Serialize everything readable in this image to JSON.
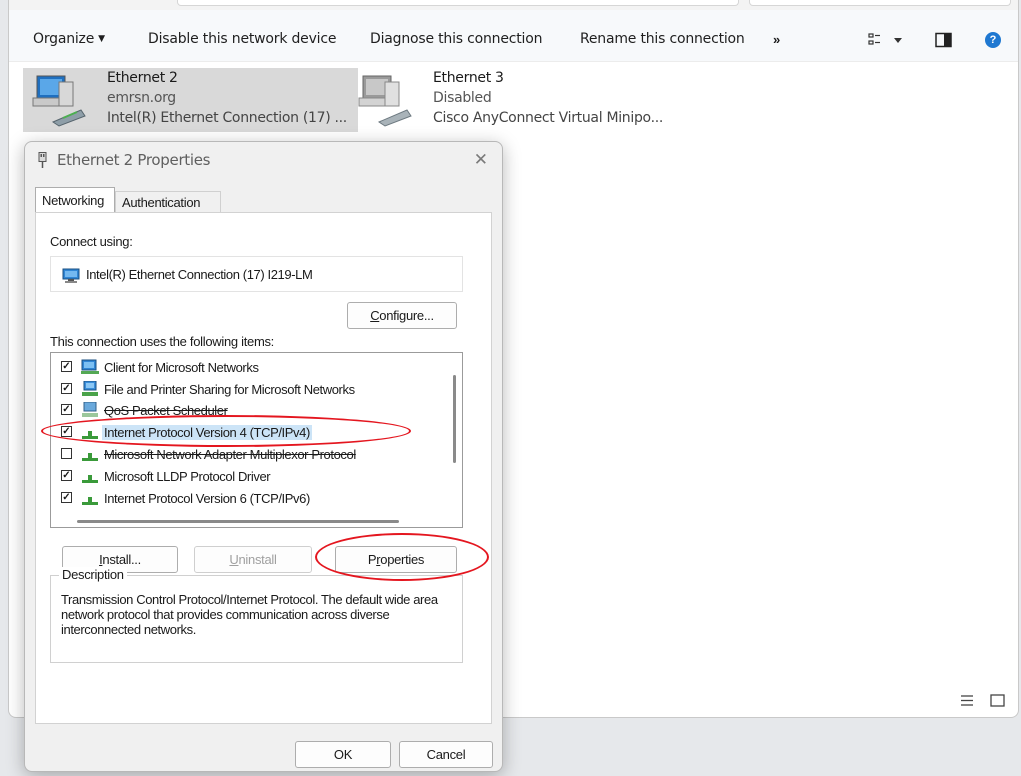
{
  "toolbar": {
    "organize": "Organize",
    "disable": "Disable this network device",
    "diagnose": "Diagnose this connection",
    "rename": "Rename this connection",
    "more": "»",
    "help": "?"
  },
  "adapters": [
    {
      "name": "Ethernet 2",
      "status": "emrsn.org",
      "device": "Intel(R) Ethernet Connection (17) ..."
    },
    {
      "name": "Ethernet 3",
      "status": "Disabled",
      "device": "Cisco AnyConnect Virtual Minipo..."
    }
  ],
  "dialog": {
    "title": "Ethernet 2 Properties",
    "tabs": [
      "Networking",
      "Authentication"
    ],
    "connect_using_label": "Connect using:",
    "adapter_name": "Intel(R) Ethernet Connection (17) I219-LM",
    "configure": "Configure...",
    "items_label": "This connection uses the following items:",
    "items": [
      {
        "label": "Client for Microsoft Networks",
        "checked": true,
        "icon": "network-client-icon"
      },
      {
        "label": "File and Printer Sharing for Microsoft Networks",
        "checked": true,
        "icon": "file-sharing-icon"
      },
      {
        "label": "QoS Packet Scheduler",
        "checked": true,
        "icon": "service-icon"
      },
      {
        "label": "Internet Protocol Version 4 (TCP/IPv4)",
        "checked": true,
        "icon": "protocol-icon"
      },
      {
        "label": "Microsoft Network Adapter Multiplexor Protocol",
        "checked": false,
        "icon": "protocol-icon"
      },
      {
        "label": "Microsoft LLDP Protocol Driver",
        "checked": true,
        "icon": "protocol-icon"
      },
      {
        "label": "Internet Protocol Version 6 (TCP/IPv6)",
        "checked": true,
        "icon": "protocol-icon"
      }
    ],
    "install": "Install...",
    "uninstall": "Uninstall",
    "properties": "Properties",
    "description_label": "Description",
    "description": "Transmission Control Protocol/Internet Protocol. The default wide area network protocol that provides communication across diverse interconnected networks.",
    "ok": "OK",
    "cancel": "Cancel"
  },
  "colors": {
    "annotation": "#e4161f",
    "selection": "#cce4f7",
    "accent": "#1f78d1"
  }
}
